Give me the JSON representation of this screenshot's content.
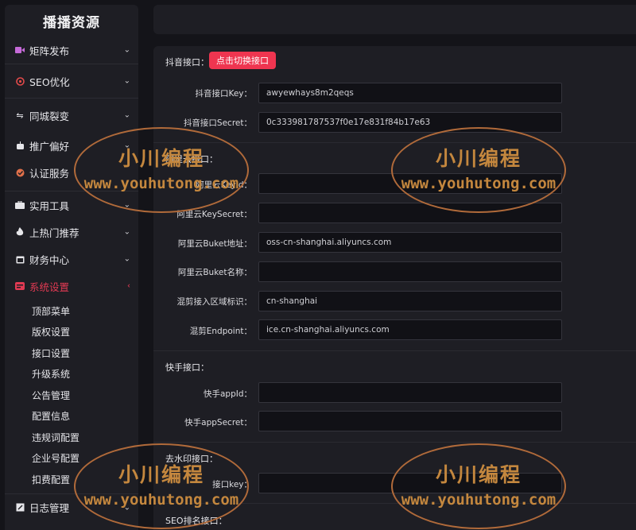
{
  "sidebar": {
    "brand": "播播资源",
    "items": [
      {
        "label": "矩阵发布",
        "icon": "video-icon"
      },
      {
        "label": "SEO优化",
        "icon": "seo-icon"
      },
      {
        "label": "同城裂变",
        "icon": "link-icon"
      },
      {
        "label": "推广偏好",
        "icon": "robot-icon"
      },
      {
        "label": "认证服务",
        "icon": "badge-icon"
      },
      {
        "label": "实用工具",
        "icon": "toolbox-icon"
      },
      {
        "label": "上热门推荐",
        "icon": "fire-icon"
      },
      {
        "label": "财务中心",
        "icon": "calendar-icon"
      },
      {
        "label": "系统设置",
        "icon": "settings-icon"
      },
      {
        "label": "日志管理",
        "icon": "log-icon"
      }
    ],
    "sub_items": [
      "顶部菜单",
      "版权设置",
      "接口设置",
      "升级系统",
      "公告管理",
      "配置信息",
      "违规词配置",
      "企业号配置",
      "扣费配置"
    ]
  },
  "main": {
    "douyin": {
      "title": "抖音接口：",
      "switch_btn": "点击切换接口",
      "key_label": "抖音接口Key：",
      "key_value": "awyewhays8m2qeqs",
      "secret_label": "抖音接口Secret：",
      "secret_value": "0c333981787537f0e17e831f84b17e63"
    },
    "aliyun": {
      "title": "阿里云接口：",
      "keyid_label": "阿里云KeyId：",
      "keyid_value": "",
      "keysecret_label": "阿里云KeySecret：",
      "keysecret_value": "",
      "bucket_addr_label": "阿里云Buket地址：",
      "bucket_addr_value": "oss-cn-shanghai.aliyuncs.com",
      "bucket_name_label": "阿里云Buket名称：",
      "bucket_name_value": "",
      "region_label": "混剪接入区域标识：",
      "region_value": "cn-shanghai",
      "endpoint_label": "混剪Endpoint：",
      "endpoint_value": "ice.cn-shanghai.aliyuncs.com"
    },
    "kuaishou": {
      "title": "快手接口：",
      "appid_label": "快手appId：",
      "appid_value": "",
      "appsecret_label": "快手appSecret：",
      "appsecret_value": ""
    },
    "watermark_api": {
      "title": "去水印接口：",
      "key_label": "接口key：",
      "key_value": ""
    },
    "seo_api": {
      "title": "SEO排名接口："
    }
  },
  "watermark": {
    "line1": "小川编程",
    "line2": "www.youhutong.com"
  }
}
